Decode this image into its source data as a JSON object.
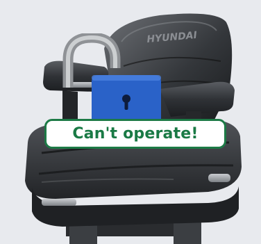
{
  "scene": {
    "seat_image": "operator-seat",
    "seat_brand": "HYUNDAI",
    "lock_icon": "padlock-open-icon"
  },
  "status": {
    "message": "Can't operate!",
    "color": "#1a7a45",
    "lock_color": "#2a62c8"
  }
}
